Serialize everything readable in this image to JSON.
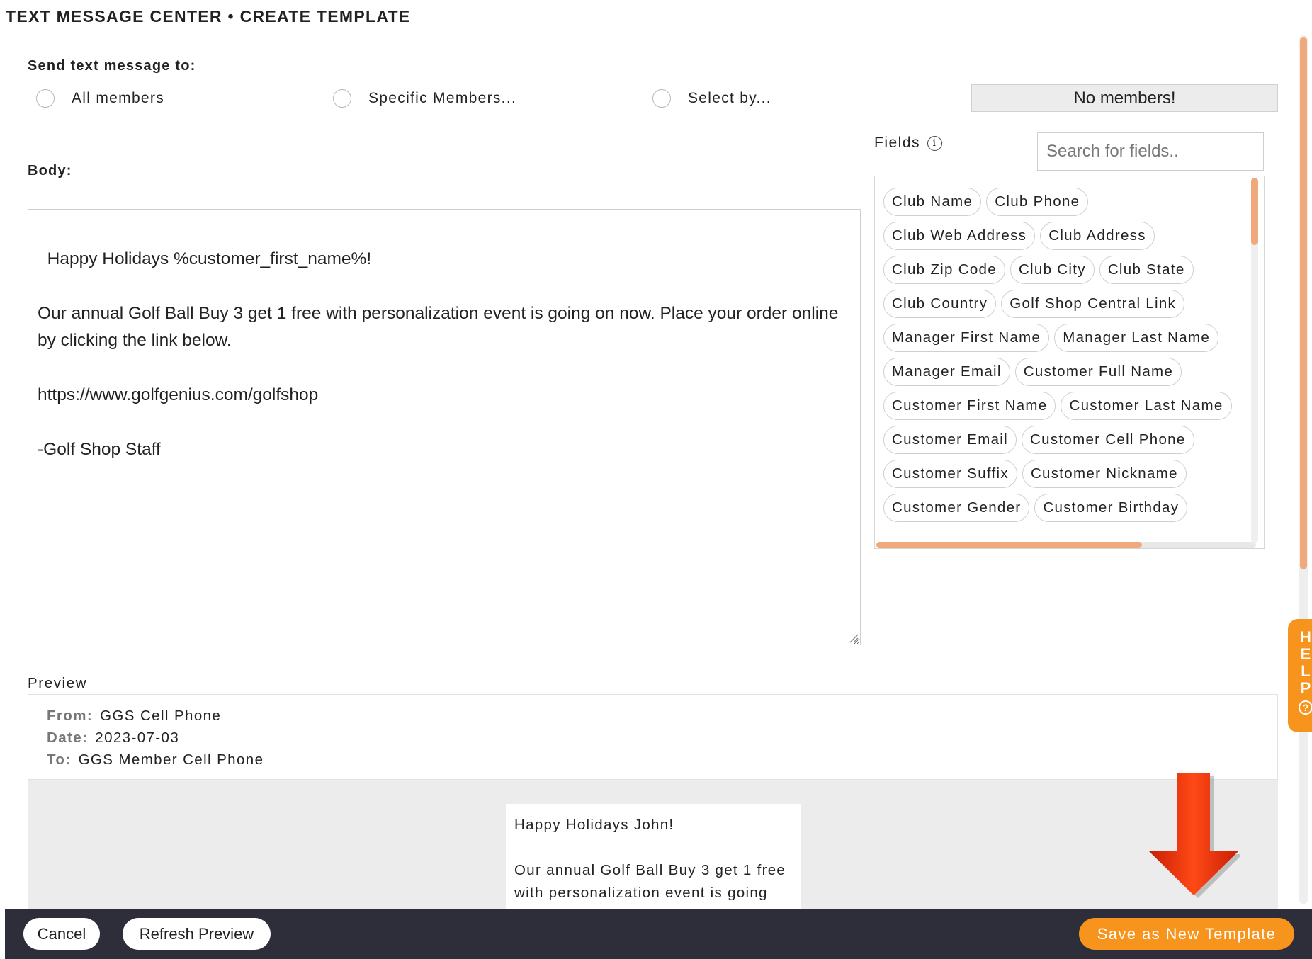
{
  "header": {
    "title": "TEXT MESSAGE CENTER • CREATE TEMPLATE"
  },
  "recipients": {
    "label": "Send text message to:",
    "options": [
      "All members",
      "Specific Members...",
      "Select by..."
    ],
    "status": "No members!"
  },
  "fields": {
    "label": "Fields",
    "info_icon": "info-icon",
    "search_placeholder": "Search for fields..",
    "chips": [
      "Club Name",
      "Club Phone",
      "Club Web Address",
      "Club Address",
      "Club Zip Code",
      "Club City",
      "Club State",
      "Club Country",
      "Golf Shop Central Link",
      "Manager First Name",
      "Manager Last Name",
      "Manager Email",
      "Customer Full Name",
      "Customer First Name",
      "Customer Last Name",
      "Customer Email",
      "Customer Cell Phone",
      "Customer Suffix",
      "Customer Nickname",
      "Customer Gender",
      "Customer Birthday"
    ]
  },
  "body": {
    "label": "Body:",
    "text": "Happy Holidays %customer_first_name%!\n\nOur annual Golf Ball Buy 3 get 1 free with personalization event is going on now. Place your order online by clicking the link below.\n\nhttps://www.golfgenius.com/golfshop\n\n-Golf Shop Staff"
  },
  "preview": {
    "label": "Preview",
    "from_label": "From:",
    "from": "GGS Cell Phone",
    "date_label": "Date:",
    "date": "2023-07-03",
    "to_label": "To:",
    "to": "GGS Member Cell Phone",
    "message": "Happy Holidays John!\n\nOur annual Golf Ball Buy 3 get 1 free with personalization event is going"
  },
  "help": {
    "letters": [
      "H",
      "E",
      "L",
      "P"
    ],
    "icon": "question-circle-icon"
  },
  "footer": {
    "cancel": "Cancel",
    "refresh": "Refresh Preview",
    "save": "Save as New Template"
  },
  "annotation": {
    "arrow_icon": "red-down-arrow-icon"
  },
  "colors": {
    "accent": "#f7941d",
    "scroll_thumb": "#f0a97a",
    "footer_bg": "#2d2e3a",
    "arrow": "#e8380d"
  }
}
